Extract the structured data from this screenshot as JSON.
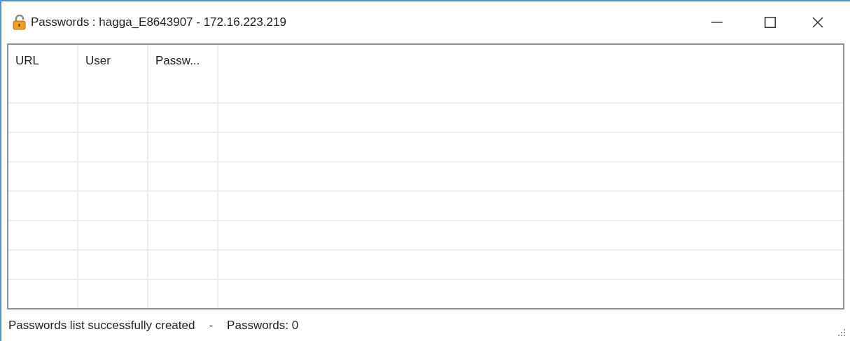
{
  "window": {
    "title": "Passwords : hagga_E8643907 - 172.16.223.219"
  },
  "table": {
    "columns": [
      "URL",
      "User",
      "Passw..."
    ]
  },
  "status_bar": {
    "message": "Passwords list successfully created",
    "separator": "-",
    "count": "Passwords: 0"
  }
}
